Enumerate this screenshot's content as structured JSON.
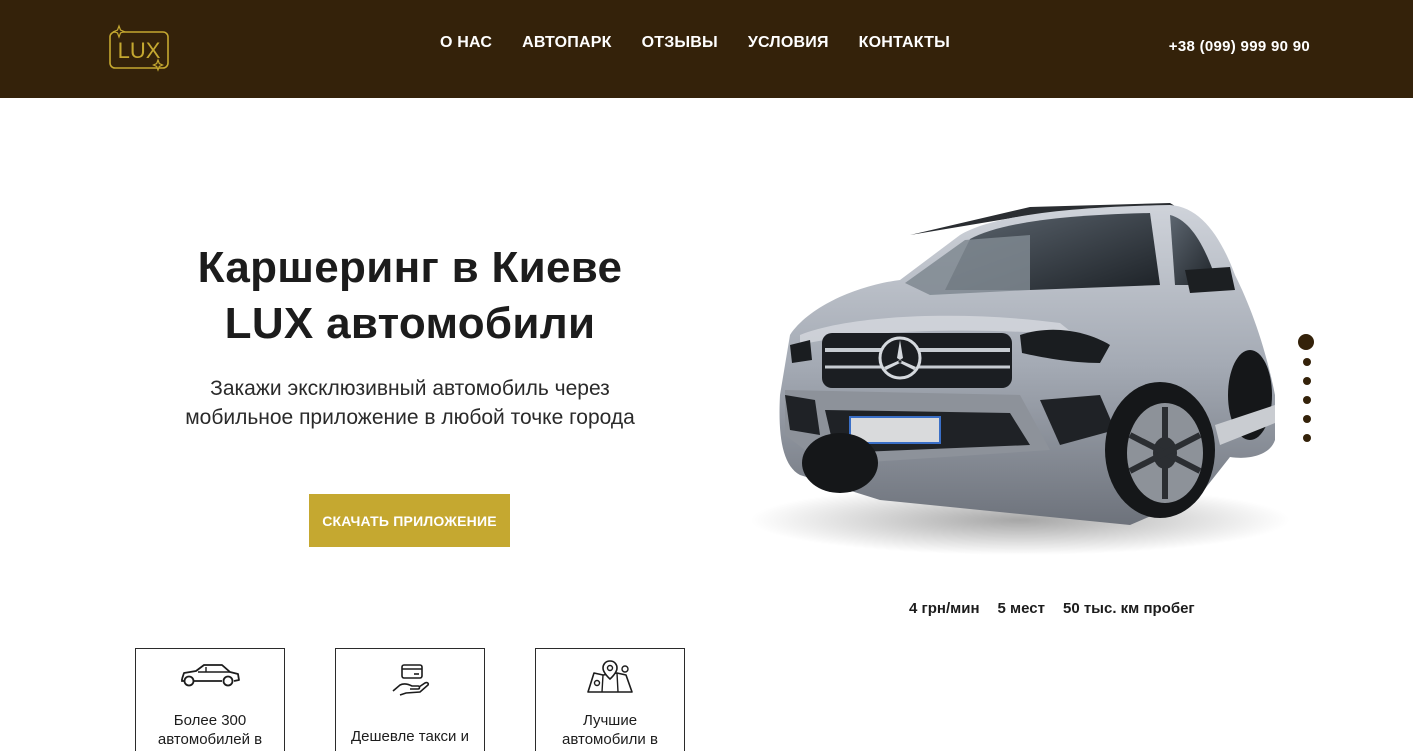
{
  "header": {
    "logo_text": "LUX",
    "nav": [
      {
        "label": "О НАС"
      },
      {
        "label": "АВТОПАРК"
      },
      {
        "label": "ОТЗЫВЫ"
      },
      {
        "label": "УСЛОВИЯ"
      },
      {
        "label": "КОНТАКТЫ"
      }
    ],
    "phone": "+38 (099) 999 90 90"
  },
  "hero": {
    "title_line1": "Каршеринг в Киеве",
    "title_line2": "LUX автомобили",
    "subtitle_line1": "Закажи эксклюзивный автомобиль через",
    "subtitle_line2": "мобильное приложение в любой точке города",
    "cta_label": "СКАЧАТЬ ПРИЛОЖЕНИЕ"
  },
  "car": {
    "image": "mercedes-gle-suv-silver",
    "specs": [
      "4 грн/мин",
      "5 мест",
      "50 тыс. км пробег"
    ]
  },
  "slider": {
    "dot_count": 6,
    "active_index": 0
  },
  "features": [
    {
      "icon": "car-icon",
      "label_line1": "Более 300",
      "label_line2": "автомобилей в"
    },
    {
      "icon": "payment-hand-icon",
      "label_line1": "Дешевле такси и",
      "label_line2": ""
    },
    {
      "icon": "map-pin-icon",
      "label_line1": "Лучшие",
      "label_line2": "автомобили в"
    }
  ],
  "colors": {
    "header_bg": "#34220a",
    "accent_gold": "#c5a830",
    "text_dark": "#1c1c1c"
  }
}
